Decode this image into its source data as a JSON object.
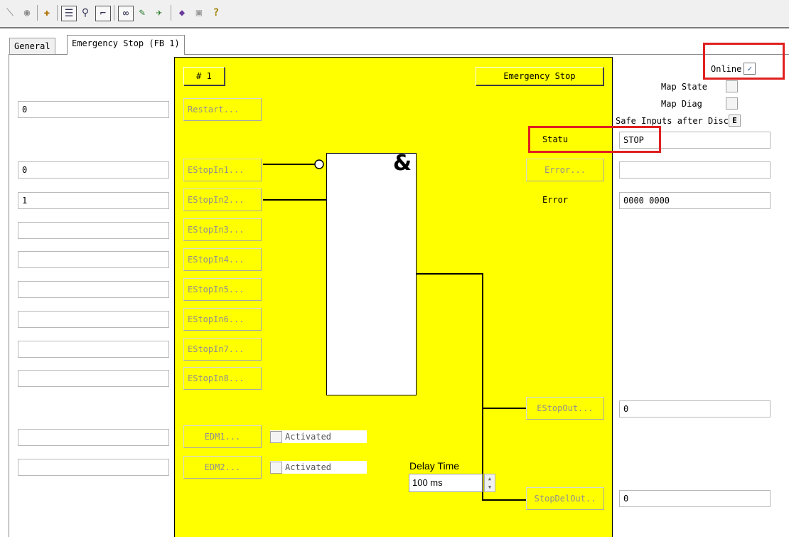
{
  "toolbar": {
    "icons": [
      "select-icon",
      "record-icon",
      "add-icon",
      "list-icon",
      "search-icon",
      "pipe-icon",
      "glasses-icon",
      "connect-icon",
      "diag-icon",
      "book-icon",
      "settings-icon",
      "help-icon"
    ]
  },
  "tabs": [
    {
      "label": "General"
    },
    {
      "label": "Emergency Stop (FB 1)"
    }
  ],
  "left_fields": {
    "restart": "0",
    "estop_in1": "0",
    "estop_in2": "1",
    "estop_in3": "",
    "estop_in4": "",
    "estop_in5": "",
    "estop_in6": "",
    "estop_in7": "",
    "estop_in8": "",
    "edm1": "",
    "edm2": ""
  },
  "block": {
    "number_label": "# 1",
    "title": "Emergency Stop",
    "restart_btn": "Restart...",
    "inputs": [
      "EStopIn1...",
      "EStopIn2...",
      "EStopIn3...",
      "EStopIn4...",
      "EStopIn5...",
      "EStopIn6...",
      "EStopIn7...",
      "EStopIn8..."
    ],
    "and_symbol": "&",
    "edm1_btn": "EDM1...",
    "edm2_btn": "EDM2...",
    "activated1": "Activated",
    "activated2": "Activated",
    "status_label": "Statu",
    "error_btn": "Error...",
    "error_label": "Error",
    "delay_label": "Delay Time",
    "delay_value": "100 ms",
    "estop_out_btn": "EStopOut...",
    "stopdel_out_btn": "StopDelOut.."
  },
  "right": {
    "online_label": "Online",
    "online_checked": "✓",
    "map_state_label": "Map State",
    "map_diag_label": "Map Diag",
    "safe_inputs_label": "Safe Inputs after Disc",
    "safe_inputs_value": "E",
    "status_value": "STOP",
    "error_field": "",
    "error_value": "0000 0000",
    "estop_out_value": "0",
    "stopdel_out_value": "0"
  },
  "colors": {
    "block_yellow": "#ffff00",
    "highlight_red": "#e02020"
  }
}
